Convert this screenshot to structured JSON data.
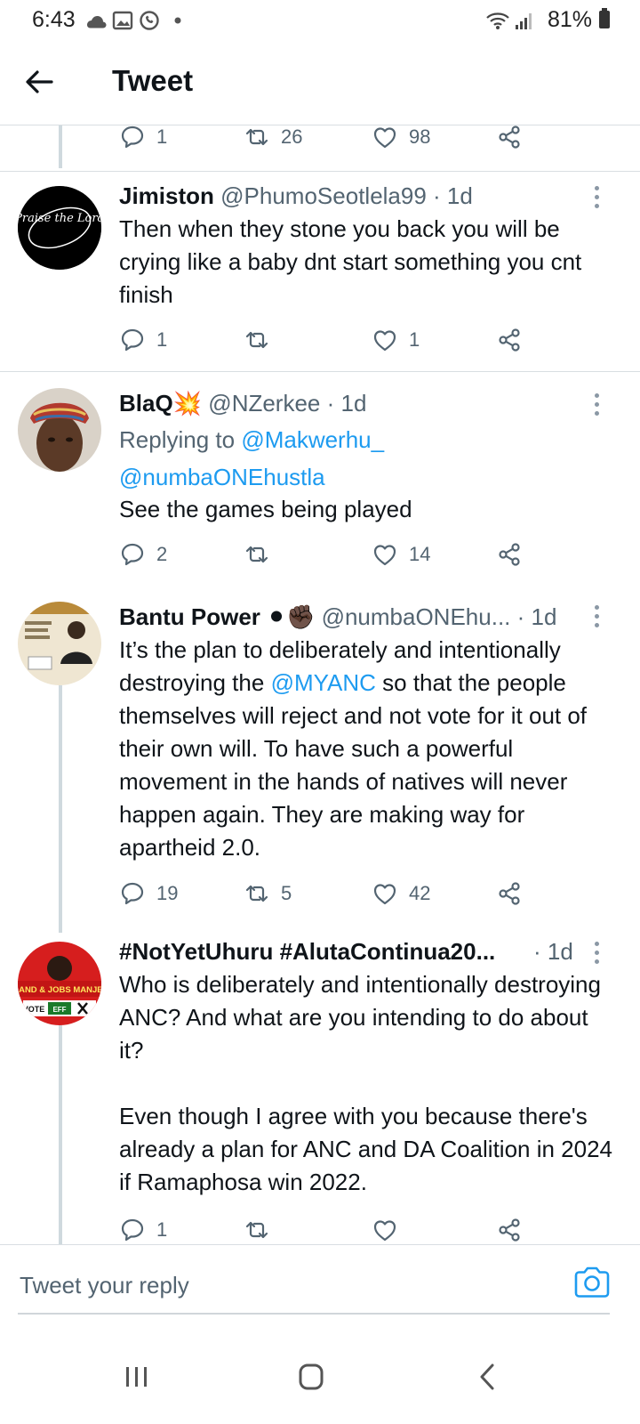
{
  "status_bar": {
    "time": "6:43",
    "battery": "81%"
  },
  "header": {
    "title": "Tweet"
  },
  "top_actions": {
    "reply_count": "1",
    "retweet_count": "26",
    "like_count": "98"
  },
  "tweets": [
    {
      "name": "Jimiston",
      "handle": "@PhumoSeotlela99",
      "time": "· 1d",
      "avatar_text": "Praise the Lord",
      "text": "Then when they stone you back you will be crying like a baby dnt start something you cnt finish",
      "reply_count": "1",
      "retweet_count": "",
      "like_count": "1"
    },
    {
      "name": "BlaQ",
      "name_emoji": "💥",
      "handle": "@NZerkee",
      "time": "· 1d",
      "replying_prefix": "Replying to",
      "replying_to_1": "@Makwerhu_",
      "replying_to_2": "@numbaONEhustla",
      "text": "See the games being played",
      "reply_count": "2",
      "retweet_count": "",
      "like_count": "14"
    },
    {
      "name": "Bantu Power",
      "name_emoji": "⚫✊🏿",
      "handle": "@numbaONEhu...",
      "time": "· 1d",
      "text_before": "It’s the plan to deliberately and intentionally destroying the ",
      "text_mention": "@MYANC",
      "text_after": " so that the people themselves will reject and not vote for it out of their own will. To have such a powerful movement in the hands of natives will never happen again. They are making way for apartheid 2.0.",
      "reply_count": "19",
      "retweet_count": "5",
      "like_count": "42"
    },
    {
      "name": "#NotYetUhuru #AlutaContinua20...",
      "time": "· 1d",
      "avatar_text_1": "LAND & JOBS MANJE!",
      "avatar_text_2": "VOTE",
      "avatar_text_3": "EFF",
      "text_para1": "Who is deliberately and intentionally destroying ANC? And what are you intending to do about it?",
      "text_para2": "Even though I agree with you because there's already a plan for ANC and DA Coalition in 2024 if Ramaphosa win 2022.",
      "reply_count": "1",
      "retweet_count": "",
      "like_count": ""
    }
  ],
  "reply_bar": {
    "placeholder": "Tweet your reply"
  },
  "colors": {
    "accent": "#1d9bf0",
    "muted": "#536471",
    "divider": "#d9dee2",
    "thread_line": "#cfd9de"
  }
}
